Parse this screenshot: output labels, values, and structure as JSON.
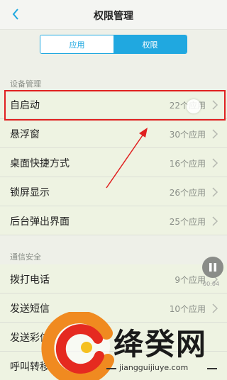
{
  "header": {
    "title": "权限管理"
  },
  "tabs": [
    {
      "label": "应用"
    },
    {
      "label": "权限"
    }
  ],
  "sections": [
    {
      "label": "设备管理",
      "items": [
        {
          "label": "自启动",
          "count": "22个应用"
        },
        {
          "label": "悬浮窗",
          "count": "30个应用"
        },
        {
          "label": "桌面快捷方式",
          "count": "16个应用"
        },
        {
          "label": "锁屏显示",
          "count": "26个应用"
        },
        {
          "label": "后台弹出界面",
          "count": "25个应用"
        }
      ]
    },
    {
      "label": "通信安全",
      "items": [
        {
          "label": "拨打电话",
          "count": "9个应用"
        },
        {
          "label": "发送短信",
          "count": "10个应用"
        },
        {
          "label": "发送彩信",
          "count": ""
        },
        {
          "label": "呼叫转移",
          "count": ""
        }
      ]
    }
  ],
  "overlay": {
    "pause_time": "00:04"
  },
  "watermark": {
    "brand": "绛癸网",
    "url": "jiangguijiuye.com"
  },
  "colors": {
    "accent": "#20a8e0",
    "highlight": "#e02020",
    "row_bg": "#eef3e2"
  }
}
